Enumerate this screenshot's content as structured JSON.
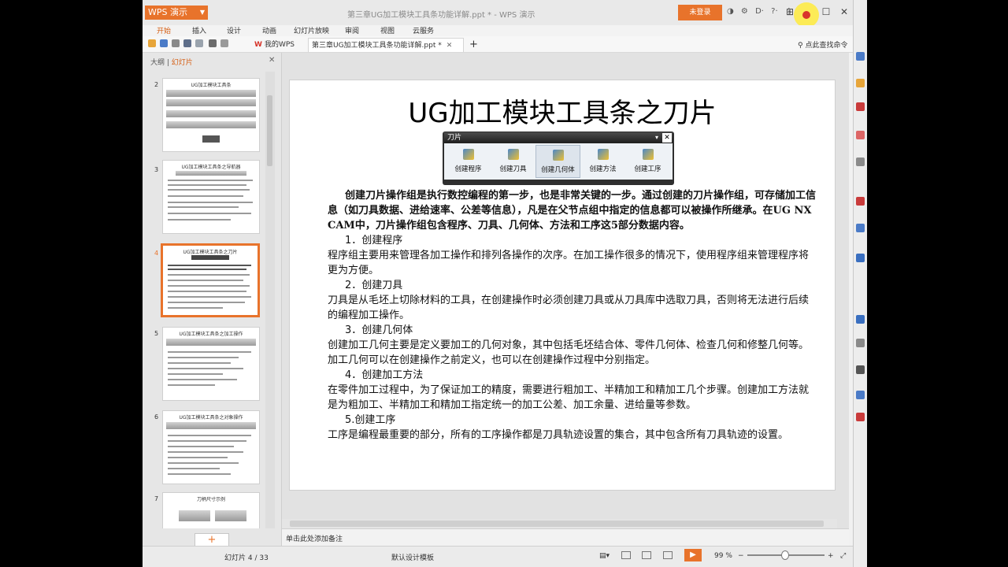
{
  "titlebar": {
    "app_name": "WPS 演示",
    "document_title": "第三章UG加工模块工具条功能详解.ppt * - WPS 演示",
    "login_label": "未登录"
  },
  "menu": {
    "items": [
      "开始",
      "插入",
      "设计",
      "动画",
      "幻灯片放映",
      "审阅",
      "视图",
      "云服务"
    ]
  },
  "tabs": {
    "my_wps": "我的WPS",
    "doc_tab": "第三章UG加工模块工具条功能详解.ppt *",
    "search_cmd": "点此查找命令"
  },
  "panel": {
    "tab_outline": "大纲",
    "tab_slides": "幻灯片",
    "thumbnails": [
      {
        "num": "2",
        "title": "UG加工模块工具条"
      },
      {
        "num": "3",
        "title": "UG加工模块工具条之导航器"
      },
      {
        "num": "4",
        "title": "UG加工模块工具条之刀片"
      },
      {
        "num": "5",
        "title": "UG加工模块工具条之加工操作"
      },
      {
        "num": "6",
        "title": "UG加工模块工具条之对象操作"
      },
      {
        "num": "7",
        "title": "刀柄尺寸示例"
      }
    ],
    "add_label": "+"
  },
  "slide": {
    "title": "UG加工模块工具条之刀片",
    "toolbar": {
      "title": "刀片",
      "items": [
        "创建程序",
        "创建刀具",
        "创建几何体",
        "创建方法",
        "创建工序"
      ]
    },
    "intro": "创建刀片操作组是执行数控编程的第一步，也是非常关键的一步。通过创建的刀片操作组，可存储加工信息（如刀具数据、进给速率、公差等信息），凡是在父节点组中指定的信息都可以被操作所继承。在UG NX CAM中，刀片操作组包含程序、刀具、几何体、方法和工序这5部分数据内容。",
    "sections": [
      {
        "heading": "1．创建程序",
        "text": "程序组主要用来管理各加工操作和排列各操作的次序。在加工操作很多的情况下，使用程序组来管理程序将更为方便。"
      },
      {
        "heading": "2．创建刀具",
        "text": "刀具是从毛坯上切除材料的工具，在创建操作时必须创建刀具或从刀具库中选取刀具，否则将无法进行后续的编程加工操作。"
      },
      {
        "heading": "3．创建几何体",
        "text": "创建加工几何主要是定义要加工的几何对象，其中包括毛坯结合体、零件几何体、检查几何和修整几何等。加工几何可以在创建操作之前定义，也可以在创建操作过程中分别指定。"
      },
      {
        "heading": "4．创建加工方法",
        "text": "在零件加工过程中，为了保证加工的精度，需要进行粗加工、半精加工和精加工几个步骤。创建加工方法就是为粗加工、半精加工和精加工指定统一的加工公差、加工余量、进给量等参数。"
      },
      {
        "heading": "5.创建工序",
        "text": "工序是编程最重要的部分，所有的工序操作都是刀具轨迹设置的集合，其中包含所有刀具轨迹的设置。"
      }
    ]
  },
  "notes": {
    "placeholder": "单击此处添加备注"
  },
  "status": {
    "slide_info": "幻灯片 4 / 33",
    "template": "默认设计模板",
    "zoom": "99 %",
    "zoom_level": 0.45
  },
  "colors": {
    "accent": "#e8732b",
    "close_red": "#d9342b"
  }
}
